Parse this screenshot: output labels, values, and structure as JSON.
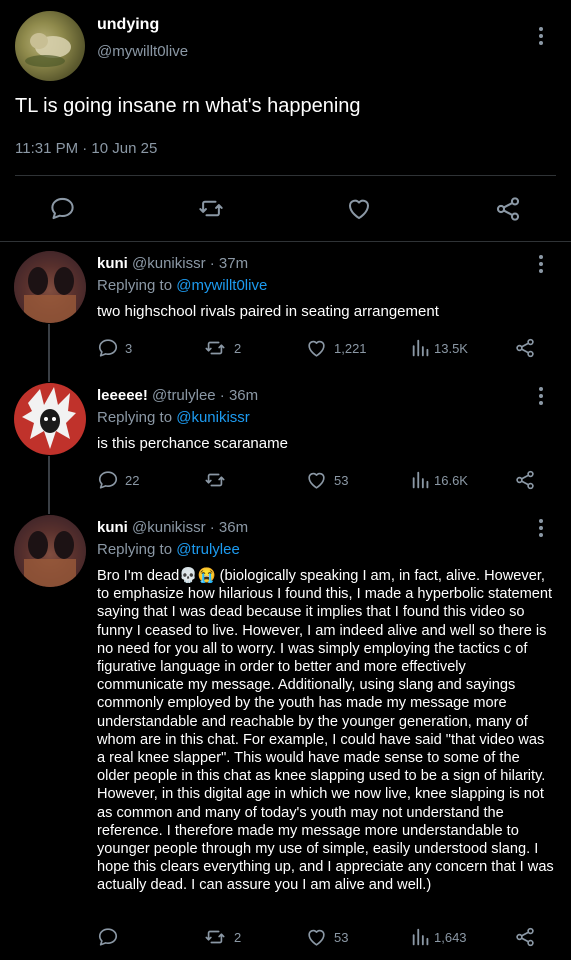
{
  "main_tweet": {
    "display_name": "undying",
    "handle": "@mywillt0live",
    "text": "TL is going insane rn what's happening",
    "timestamp": "11:31 PM · 10 Jun 25"
  },
  "replies": [
    {
      "display_name": "kuni",
      "handle_time": "@kunikissr · 37m",
      "replying_prefix": "Replying to ",
      "replying_to": "@mywillt0live",
      "text": "two highschool rivals paired in seating arrangement",
      "replies": "3",
      "retweets": "2",
      "likes": "1,221",
      "views": "13.5K"
    },
    {
      "display_name": "leeeee!",
      "handle_time": "@trulylee · 36m",
      "replying_prefix": "Replying to ",
      "replying_to": "@kunikissr",
      "text": "is this perchance scaraname",
      "replies": "22",
      "retweets": "",
      "likes": "53",
      "views": "16.6K"
    },
    {
      "display_name": "kuni",
      "handle_time": "@kunikissr · 36m",
      "replying_prefix": "Replying to ",
      "replying_to": "@trulylee",
      "text": "Bro I'm dead💀😭 (biologically speaking I am, in fact, alive. However, to emphasize how hilarious I found this, I made a hyperbolic statement saying that I was dead because it implies that I found this video so funny I ceased to live. However, I am indeed alive and well so there is no need for you all to worry. I was simply employing the tactics c of figurative language in order to better and more effectively communicate my message. Additionally, using slang and sayings commonly employed by the youth has made my message more understandable and reachable by the younger generation, many of whom are in this chat. For example, I could have said \"that video was a real knee slapper\". This would have made sense to some of the older people in this chat as knee slapping used to be a sign of hilarity. However, in this digital age in which we now live, knee slapping is not as common and many of today's youth may not understand the reference. I therefore made my message more understandable to younger people through my use of simple, easily understood slang. I hope this clears everything up, and I appreciate any concern that I was actually dead. I can assure you I am alive and well.)",
      "replies": "",
      "retweets": "2",
      "likes": "53",
      "views": "1,643"
    }
  ],
  "colors": {
    "background": "#000000",
    "text": "#e7e9ea",
    "secondary": "#8b98a5",
    "link": "#1d9bf0",
    "divider": "#2f3336"
  },
  "icons": [
    "reply-icon",
    "retweet-icon",
    "like-icon",
    "share-icon",
    "views-icon",
    "more-icon"
  ]
}
